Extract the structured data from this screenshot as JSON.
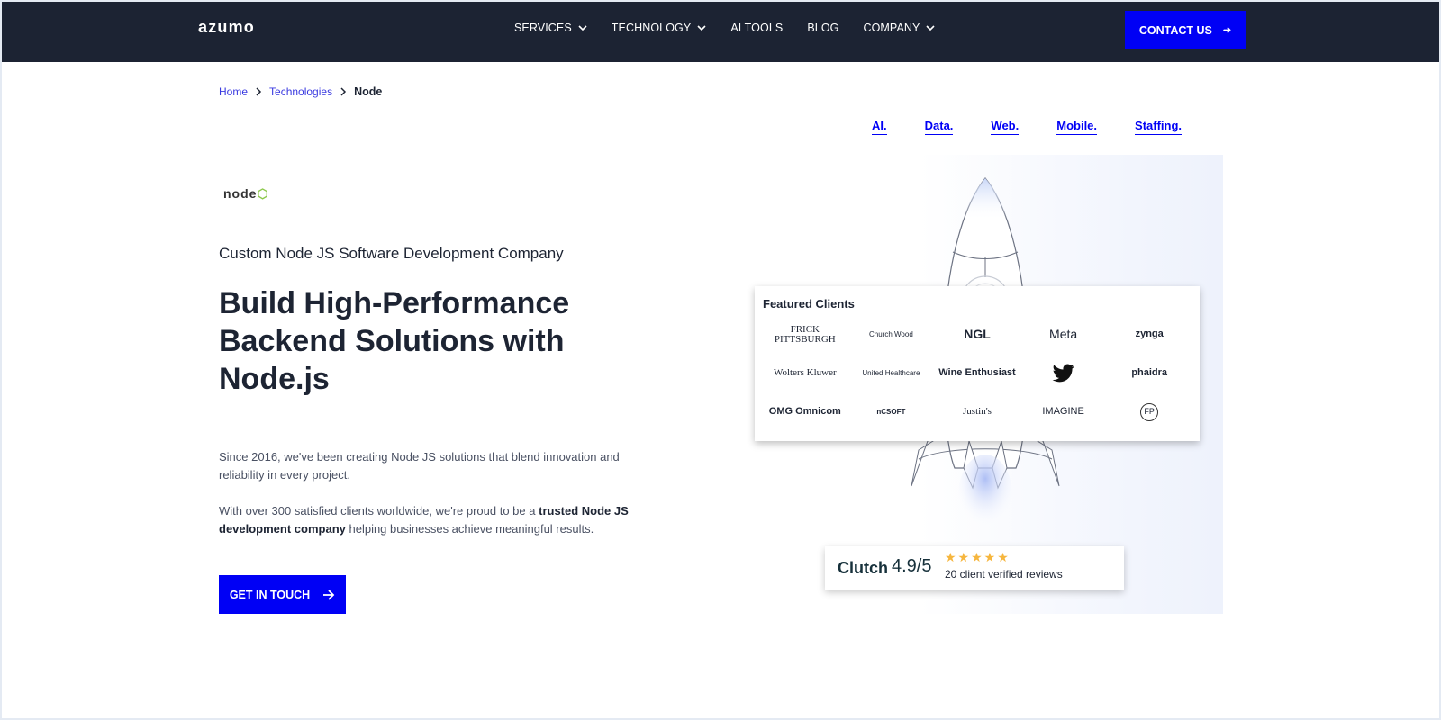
{
  "nav": {
    "logo": "azumo",
    "items": [
      {
        "label": "SERVICES",
        "dropdown": true
      },
      {
        "label": "TECHNOLOGY",
        "dropdown": true
      },
      {
        "label": "AI TOOLS",
        "dropdown": false
      },
      {
        "label": "BLOG",
        "dropdown": false
      },
      {
        "label": "COMPANY",
        "dropdown": true
      }
    ],
    "contact_label": "CONTACT US",
    "contact_icon": "arrow-right-icon"
  },
  "breadcrumb": {
    "home": "Home",
    "technologies": "Technologies",
    "current": "Node"
  },
  "tags": [
    "AI.",
    "Data.",
    "Web.",
    "Mobile.",
    "Staffing."
  ],
  "hero": {
    "logo_text": "node",
    "kicker": "Custom Node JS Software Development Company",
    "headline": "Build High-Performance Backend Solutions with Node.js",
    "p1": "Since 2016, we've been creating Node JS solutions that blend innovation and reliability in every project.",
    "p2_start": "With over 300 satisfied clients worldwide, we're proud to be a ",
    "p2_bold": "trusted Node JS development company",
    "p2_end": " helping businesses achieve meaningful results.",
    "cta": "GET IN TOUCH"
  },
  "clients": {
    "title": "Featured Clients",
    "logos": [
      "FRICK PITTSBURGH",
      "Church Wood",
      "NGL",
      "Meta",
      "zynga",
      "Wolters Kluwer",
      "United Healthcare",
      "Wine Enthusiast",
      "twitter",
      "phaidra",
      "OMG Omnicom",
      "nCSOFT",
      "Justin's",
      "IMAGINE",
      "FP"
    ]
  },
  "clutch": {
    "logo": "Clutch",
    "score": "4.9/5",
    "stars": "★★★★★",
    "reviews": "20 client verified reviews"
  },
  "colors": {
    "nav_bg": "#1c2333",
    "accent": "#0000f5",
    "text": "#1d2433",
    "star": "#f6b63e"
  }
}
